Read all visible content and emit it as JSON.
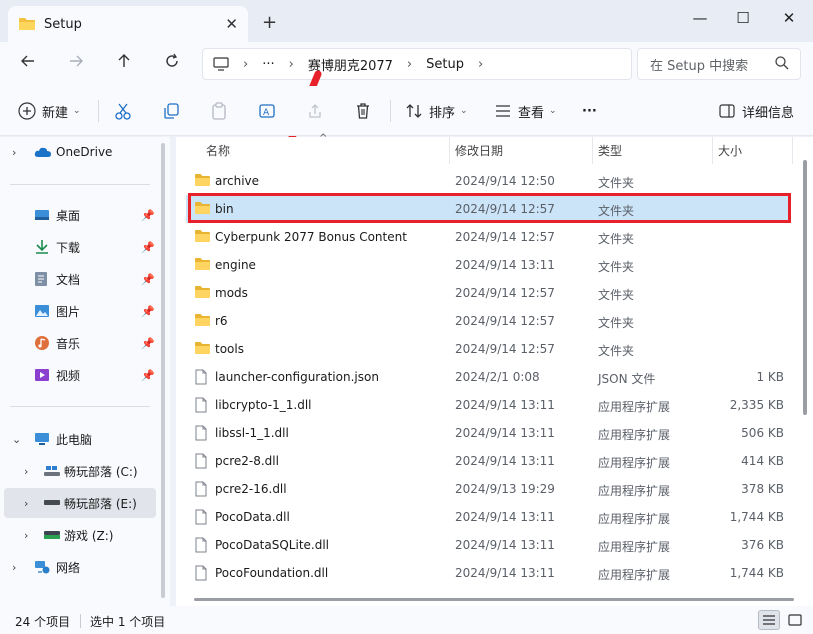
{
  "window": {
    "tab_title": "Setup",
    "new_tab": "+",
    "minimize": "—",
    "maximize": "☐",
    "close": "✕"
  },
  "address": {
    "ellipsis": "···",
    "crumbs": [
      "赛博朋克2077",
      "Setup"
    ],
    "search_placeholder": "在 Setup 中搜索"
  },
  "toolbar": {
    "new_label": "新建",
    "sort_label": "排序",
    "view_label": "查看",
    "more_label": "···",
    "details_label": "详细信息"
  },
  "sidebar": {
    "items": [
      {
        "label": "OneDrive"
      },
      {
        "label": "桌面"
      },
      {
        "label": "下载"
      },
      {
        "label": "文档"
      },
      {
        "label": "图片"
      },
      {
        "label": "音乐"
      },
      {
        "label": "视频"
      },
      {
        "label": "此电脑"
      },
      {
        "label": "畅玩部落 (C:)"
      },
      {
        "label": "畅玩部落 (E:)"
      },
      {
        "label": "游戏 (Z:)"
      },
      {
        "label": "网络"
      }
    ]
  },
  "columns": {
    "name": "名称",
    "date": "修改日期",
    "type": "类型",
    "size": "大小"
  },
  "files": [
    {
      "name": "archive",
      "date": "2024/9/14 12:50",
      "type": "文件夹",
      "size": "",
      "kind": "folder"
    },
    {
      "name": "bin",
      "date": "2024/9/14 12:57",
      "type": "文件夹",
      "size": "",
      "kind": "folder"
    },
    {
      "name": "Cyberpunk 2077 Bonus Content",
      "date": "2024/9/14 12:57",
      "type": "文件夹",
      "size": "",
      "kind": "folder"
    },
    {
      "name": "engine",
      "date": "2024/9/14 13:11",
      "type": "文件夹",
      "size": "",
      "kind": "folder"
    },
    {
      "name": "mods",
      "date": "2024/9/14 12:57",
      "type": "文件夹",
      "size": "",
      "kind": "folder"
    },
    {
      "name": "r6",
      "date": "2024/9/14 12:57",
      "type": "文件夹",
      "size": "",
      "kind": "folder"
    },
    {
      "name": "tools",
      "date": "2024/9/14 12:57",
      "type": "文件夹",
      "size": "",
      "kind": "folder"
    },
    {
      "name": "launcher-configuration.json",
      "date": "2024/2/1 0:08",
      "type": "JSON 文件",
      "size": "1 KB",
      "kind": "file"
    },
    {
      "name": "libcrypto-1_1.dll",
      "date": "2024/9/14 13:11",
      "type": "应用程序扩展",
      "size": "2,335 KB",
      "kind": "file"
    },
    {
      "name": "libssl-1_1.dll",
      "date": "2024/9/14 13:11",
      "type": "应用程序扩展",
      "size": "506 KB",
      "kind": "file"
    },
    {
      "name": "pcre2-8.dll",
      "date": "2024/9/14 13:11",
      "type": "应用程序扩展",
      "size": "414 KB",
      "kind": "file"
    },
    {
      "name": "pcre2-16.dll",
      "date": "2024/9/13 19:29",
      "type": "应用程序扩展",
      "size": "378 KB",
      "kind": "file"
    },
    {
      "name": "PocoData.dll",
      "date": "2024/9/14 13:11",
      "type": "应用程序扩展",
      "size": "1,744 KB",
      "kind": "file"
    },
    {
      "name": "PocoDataSQLite.dll",
      "date": "2024/9/14 13:11",
      "type": "应用程序扩展",
      "size": "376 KB",
      "kind": "file"
    },
    {
      "name": "PocoFoundation.dll",
      "date": "2024/9/14 13:11",
      "type": "应用程序扩展",
      "size": "1,744 KB",
      "kind": "file"
    }
  ],
  "status": {
    "item_count": "24 个项目",
    "selected": "选中 1 个项目"
  },
  "colors": {
    "accent": "#0067c0",
    "folder": "#f3c142",
    "selection": "#cce4f7",
    "highlight_box": "#e8202a"
  }
}
